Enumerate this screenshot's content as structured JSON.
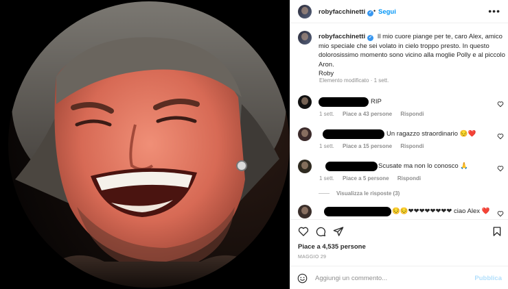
{
  "header": {
    "username": "robyfacchinetti",
    "verified_mark": "✓",
    "dot": "•",
    "follow_label": "Segui",
    "more_glyph": "•••"
  },
  "caption": {
    "username": "robyfacchinetti",
    "text": "Il mio cuore piange per te, caro Alex, amico mio speciale che sei volato in cielo troppo presto. In questo dolorosissimo momento sono vicino alla moglie Polly e al piccolo Aron.",
    "signature": "Roby",
    "meta": "Elemento modificato · 1 sett."
  },
  "comments": [
    {
      "text": "RIP",
      "time": "1 sett.",
      "likes": "Piace a 43 persone",
      "reply": "Rispondi"
    },
    {
      "text": "Un ragazzo straordinario 😔❤️",
      "time": "1 sett.",
      "likes": "Piace a 15 persone",
      "reply": "Rispondi"
    },
    {
      "text": "Scusate ma non lo conosco 🙏",
      "time": "1 sett.",
      "likes": "Piace a 5 persone",
      "reply": "Rispondi"
    },
    {
      "text": "😔😔❤❤❤❤❤❤❤❤ ciao Alex ❤️"
    }
  ],
  "view_replies": "Visualizza le risposte (3)",
  "footer": {
    "likes": "Piace a 4,535 persone",
    "date": "MAGGIO 29"
  },
  "add_comment": {
    "placeholder": "Aggiungi un commento...",
    "publish_label": "Pubblica"
  },
  "colors": {
    "accent": "#0095f6",
    "publish_disabled": "#b2dffc",
    "muted": "#8e8e8e"
  }
}
